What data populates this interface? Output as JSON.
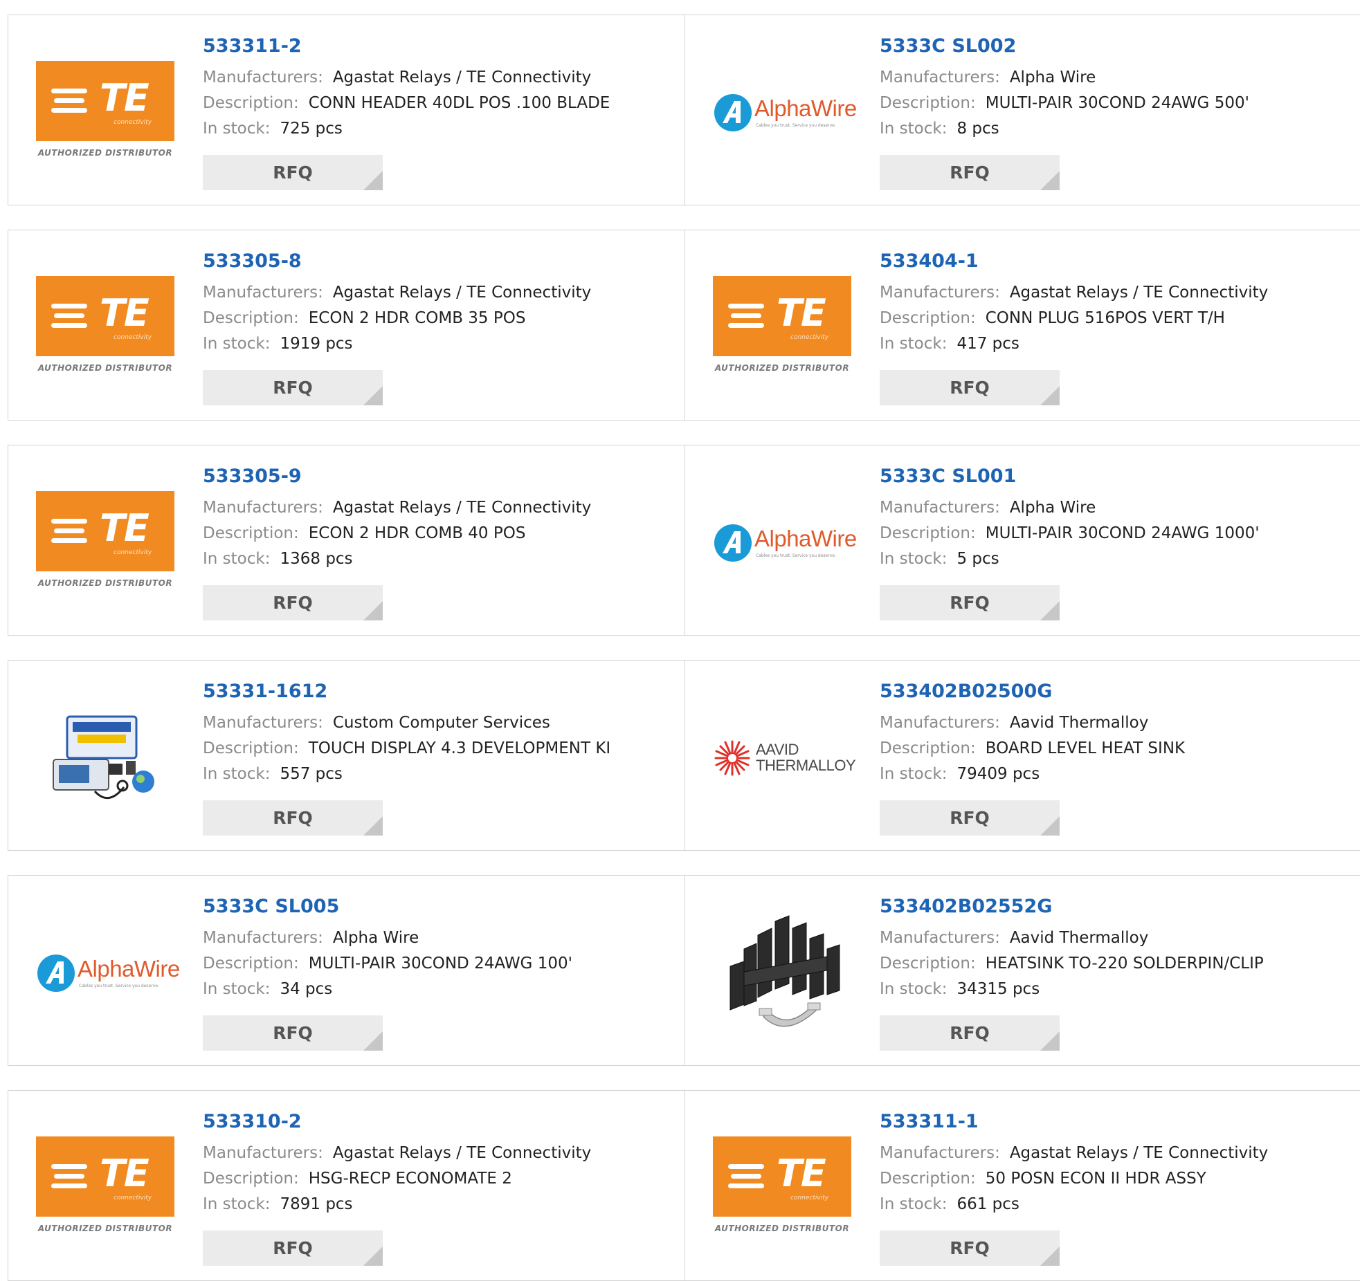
{
  "labels": {
    "manufacturers": "Manufacturers:",
    "description": "Description:",
    "in_stock": "In stock:",
    "rfq": "RFQ"
  },
  "colors": {
    "part_link": "#1e64b4",
    "te_orange": "#f18a20",
    "alpha_blue": "#1a9ad6",
    "alpha_orange": "#e05a2b",
    "aavid_red": "#e0302a"
  },
  "logos": {
    "te": {
      "brand": "TE",
      "sub": "connectivity",
      "tag": "AUTHORIZED DISTRIBUTOR"
    },
    "alphawire": {
      "brand": "AlphaWire",
      "tagline": "Cables you trust. Service you deserve."
    },
    "aavid": {
      "line1": "AAVID",
      "line2": "THERMALLOY"
    }
  },
  "products": [
    {
      "part": "533311-2",
      "manufacturer": "Agastat Relays / TE Connectivity",
      "description": "CONN HEADER 40DL POS .100 BLADE",
      "stock": "725 pcs",
      "logo": "te-logo"
    },
    {
      "part": "5333C SL002",
      "manufacturer": "Alpha Wire",
      "description": "MULTI-PAIR 30COND 24AWG 500'",
      "stock": "8 pcs",
      "logo": "alphawire-logo"
    },
    {
      "part": "533305-8",
      "manufacturer": "Agastat Relays / TE Connectivity",
      "description": "ECON 2 HDR COMB 35 POS",
      "stock": "1919 pcs",
      "logo": "te-logo"
    },
    {
      "part": "533404-1",
      "manufacturer": "Agastat Relays / TE Connectivity",
      "description": "CONN PLUG 516POS VERT T/H",
      "stock": "417 pcs",
      "logo": "te-logo"
    },
    {
      "part": "533305-9",
      "manufacturer": "Agastat Relays / TE Connectivity",
      "description": "ECON 2 HDR COMB 40 POS",
      "stock": "1368 pcs",
      "logo": "te-logo"
    },
    {
      "part": "5333C SL001",
      "manufacturer": "Alpha Wire",
      "description": "MULTI-PAIR 30COND 24AWG 1000'",
      "stock": "5 pcs",
      "logo": "alphawire-logo"
    },
    {
      "part": "53331-1612",
      "manufacturer": "Custom Computer Services",
      "description": "TOUCH DISPLAY 4.3 DEVELOPMENT KI",
      "stock": "557 pcs",
      "logo": "devkit-image"
    },
    {
      "part": "533402B02500G",
      "manufacturer": "Aavid Thermalloy",
      "description": "BOARD LEVEL HEAT SINK",
      "stock": "79409 pcs",
      "logo": "aavid-logo"
    },
    {
      "part": "5333C SL005",
      "manufacturer": "Alpha Wire",
      "description": "MULTI-PAIR 30COND 24AWG 100'",
      "stock": "34 pcs",
      "logo": "alphawire-logo"
    },
    {
      "part": "533402B02552G",
      "manufacturer": "Aavid Thermalloy",
      "description": "HEATSINK TO-220 SOLDERPIN/CLIP",
      "stock": "34315 pcs",
      "logo": "heatsink-image"
    },
    {
      "part": "533310-2",
      "manufacturer": "Agastat Relays / TE Connectivity",
      "description": "HSG-RECP ECONOMATE 2",
      "stock": "7891 pcs",
      "logo": "te-logo"
    },
    {
      "part": "533311-1",
      "manufacturer": "Agastat Relays / TE Connectivity",
      "description": "50 POSN ECON II HDR ASSY",
      "stock": "661 pcs",
      "logo": "te-logo"
    }
  ]
}
